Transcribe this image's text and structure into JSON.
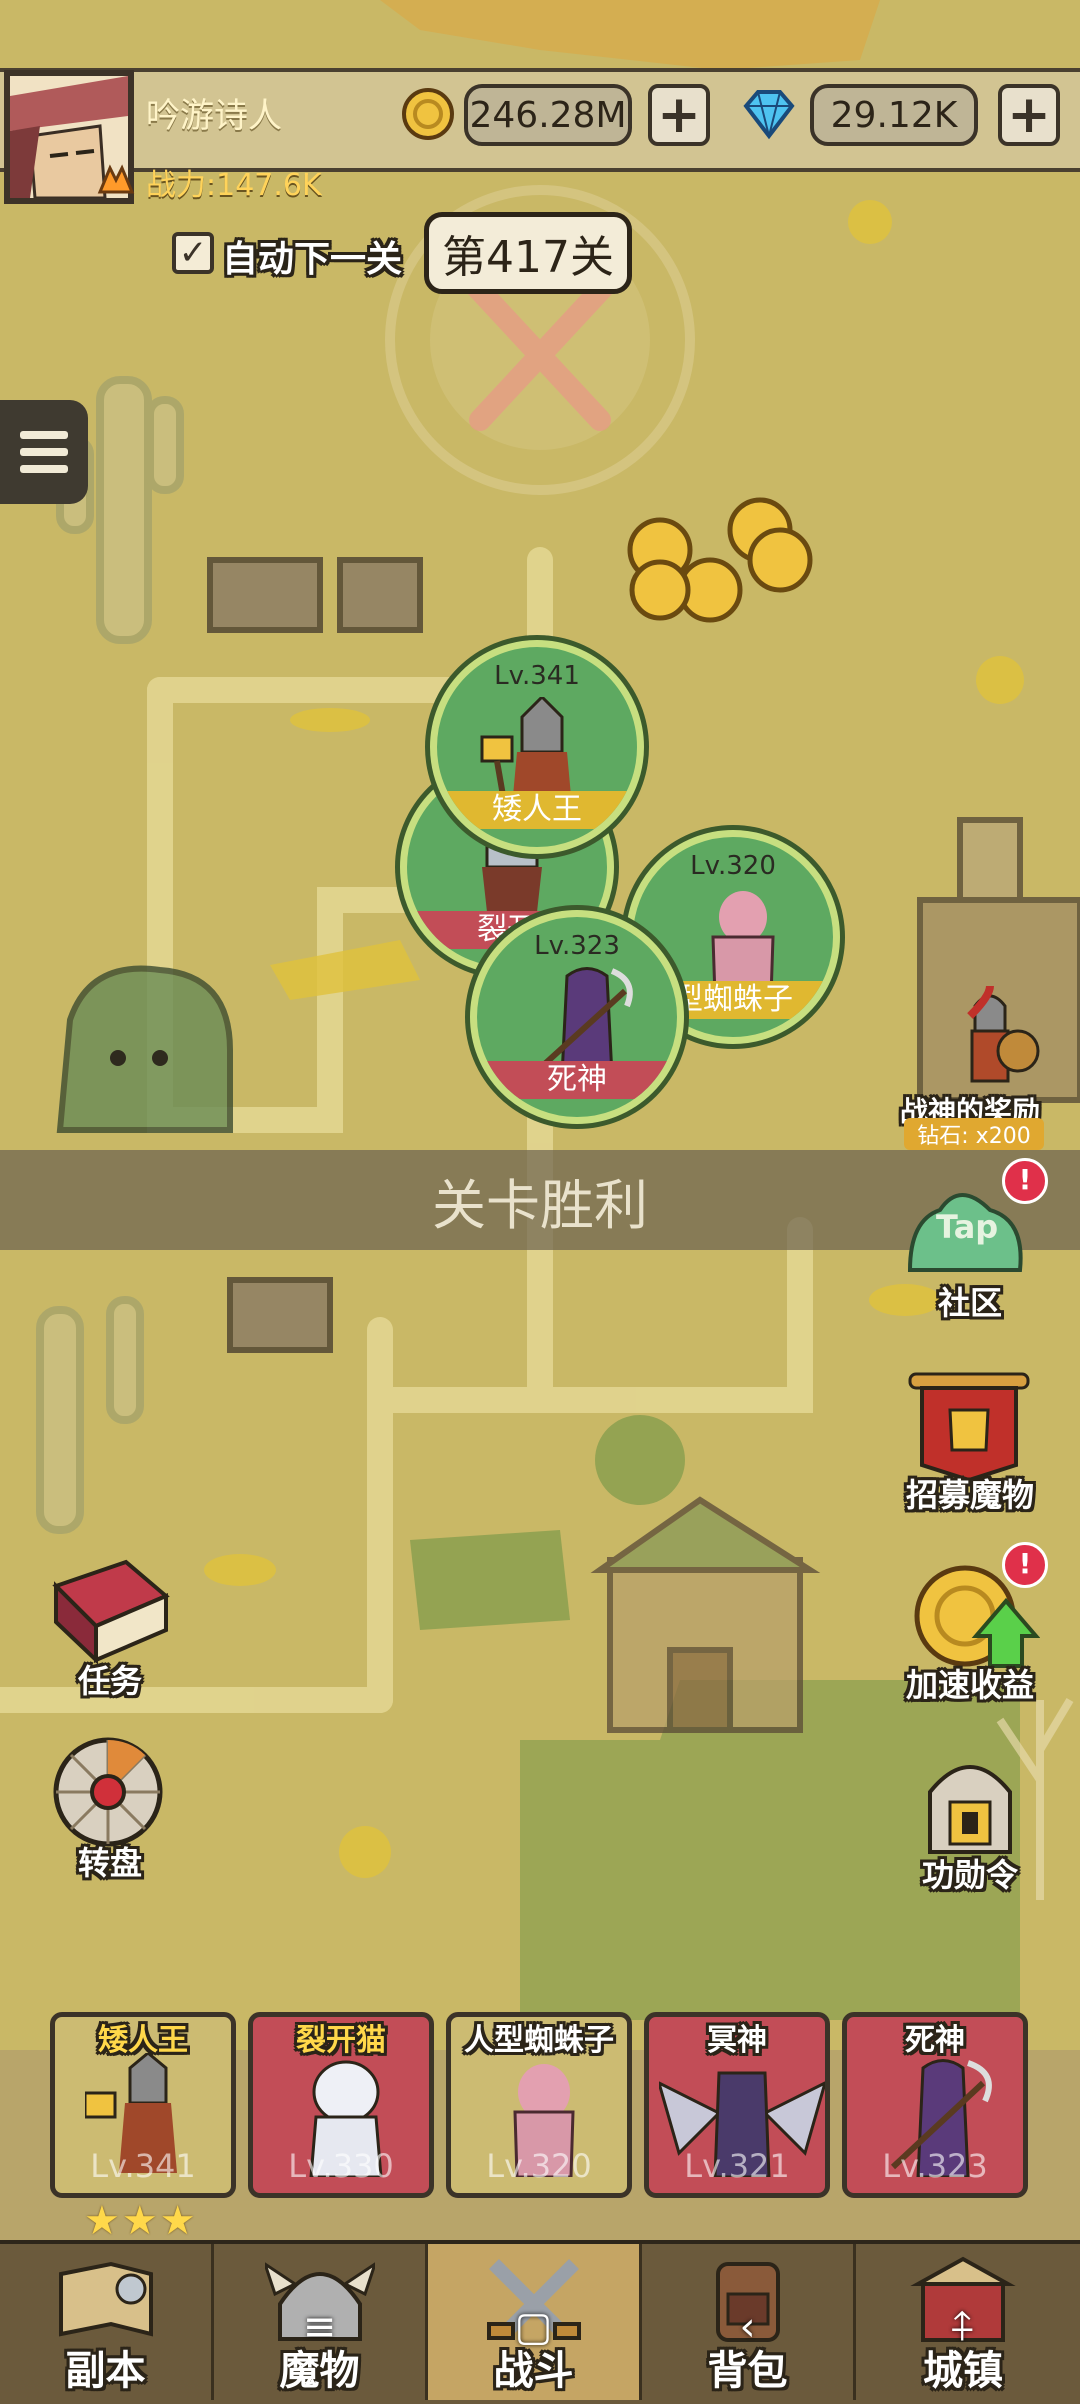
{
  "player": {
    "name": "吟游诗人",
    "power": "战力:147.6K"
  },
  "currency": {
    "gold": "246.28M",
    "diamonds": "29.12K",
    "plus": "+"
  },
  "stage": {
    "auto_next": "自动下一关",
    "auto_checked": true,
    "current": "第417关"
  },
  "field_units": [
    {
      "level": "Lv.341",
      "name": "矮人王",
      "name_color": "#e0b830"
    },
    {
      "level": "",
      "name": "裂开",
      "name_color": "#c24d57"
    },
    {
      "level": "Lv.320",
      "name": "型蜘蛛子",
      "name_color": "#e0b830"
    },
    {
      "level": "Lv.323",
      "name": "死神",
      "name_color": "#c24d57"
    }
  ],
  "victory_text": "关卡胜利",
  "right_side": {
    "event_title": "战神的奖励",
    "event_reward": "钻石: x200",
    "community": "社区",
    "community_logo": "Tap",
    "recruit": "招募魔物",
    "speed_up": "加速收益",
    "merit": "功勋令",
    "alert": "!"
  },
  "left_side": {
    "quests": "任务",
    "wheel": "转盘"
  },
  "heroes": [
    {
      "name": "矮人王",
      "level": "Lv.341",
      "bg": "#ccbb72"
    },
    {
      "name": "裂开猫",
      "level": "Lv.330",
      "bg": "#c24d57"
    },
    {
      "name": "人型蜘蛛子",
      "level": "Lv.320",
      "bg": "#ccbb72"
    },
    {
      "name": "冥神",
      "level": "Lv.321",
      "bg": "#c24d57"
    },
    {
      "name": "死神",
      "level": "Lv.323",
      "bg": "#c24d57"
    }
  ],
  "hero_stars": 3,
  "stars_text": "★★★",
  "nav": {
    "tabs": [
      "副本",
      "魔物",
      "战斗",
      "背包",
      "城镇"
    ],
    "active": "战斗",
    "system_glyphs": [
      "≡",
      "▢",
      "‹",
      "⍏"
    ]
  },
  "colors": {
    "map": "#c9b866",
    "field_green": "#5ea961",
    "gold": "#e0b830",
    "pink": "#c24d57"
  }
}
